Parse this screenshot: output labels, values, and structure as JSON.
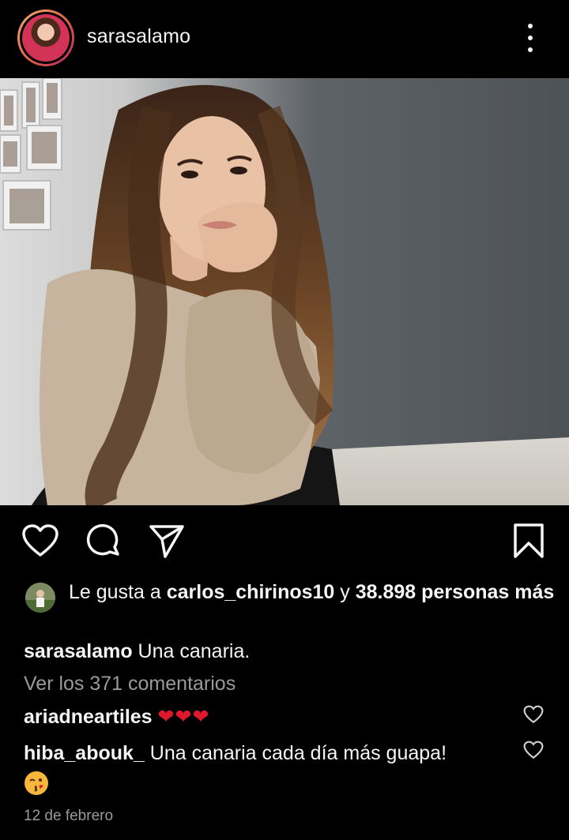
{
  "header": {
    "username": "sarasalamo"
  },
  "likes": {
    "prefix": "Le gusta a ",
    "first_liker": "carlos_chirinos10",
    "connector": " y ",
    "others": "38.898 personas más"
  },
  "caption": {
    "username": "sarasalamo",
    "text": " Una canaria."
  },
  "view_comments": "Ver los 371 comentarios",
  "comments": [
    {
      "username": "ariadneartiles",
      "text": " ❤️❤️❤️",
      "hearts": "❤❤❤"
    },
    {
      "username": "hiba_abouk_",
      "text": " Una canaria cada día más guapa!"
    }
  ],
  "date": "12 de febrero",
  "icons": {
    "like": "heart-icon",
    "comment": "comment-icon",
    "share": "send-icon",
    "save": "bookmark-icon",
    "more": "more-vertical-icon"
  },
  "colors": {
    "background": "#000000",
    "text": "#f5f5f5",
    "muted": "#9a9a9a",
    "heart_red": "#e0182d"
  }
}
